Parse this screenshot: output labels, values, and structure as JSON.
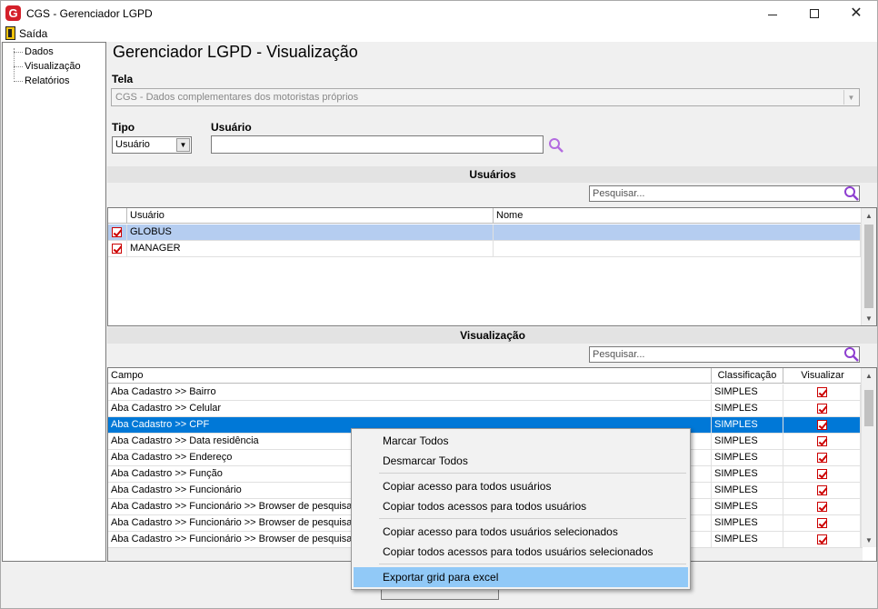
{
  "window": {
    "app_logo_letter": "G",
    "title": "CGS - Gerenciador LGPD",
    "minimize_icon": "minimize-icon",
    "maximize_icon": "maximize-icon",
    "close_icon": "close-icon"
  },
  "menu": {
    "exit_label": "Saída"
  },
  "sidebar": {
    "items": [
      {
        "label": "Dados"
      },
      {
        "label": "Visualização"
      },
      {
        "label": "Relatórios"
      }
    ]
  },
  "main": {
    "title": "Gerenciador LGPD - Visualização",
    "tela_label": "Tela",
    "tela_value": "CGS - Dados complementares dos motoristas próprios",
    "tipo_label": "Tipo",
    "tipo_value": "Usuário",
    "usuario_label": "Usuário",
    "usuario_value": ""
  },
  "usuarios_section": {
    "title": "Usuários",
    "search_placeholder": "Pesquisar...",
    "columns": [
      "Usuário",
      "Nome"
    ],
    "rows": [
      {
        "checked": true,
        "usuario": "GLOBUS",
        "nome": ""
      },
      {
        "checked": true,
        "usuario": "MANAGER",
        "nome": ""
      }
    ]
  },
  "visualizacao_section": {
    "title": "Visualização",
    "search_placeholder": "Pesquisar...",
    "columns": [
      "Campo",
      "Classificação",
      "Visualizar"
    ],
    "rows": [
      {
        "campo": "Aba Cadastro >> Bairro",
        "classificacao": "SIMPLES",
        "visualizar": true
      },
      {
        "campo": "Aba Cadastro >> Celular",
        "classificacao": "SIMPLES",
        "visualizar": true
      },
      {
        "campo": "Aba Cadastro >> CPF",
        "classificacao": "SIMPLES",
        "visualizar": true
      },
      {
        "campo": "Aba Cadastro >> Data residência",
        "classificacao": "SIMPLES",
        "visualizar": true
      },
      {
        "campo": "Aba Cadastro >> Endereço",
        "classificacao": "SIMPLES",
        "visualizar": true
      },
      {
        "campo": "Aba Cadastro >> Função",
        "classificacao": "SIMPLES",
        "visualizar": true
      },
      {
        "campo": "Aba Cadastro >> Funcionário",
        "classificacao": "SIMPLES",
        "visualizar": true
      },
      {
        "campo": "Aba Cadastro >> Funcionário >> Browser de pesquisa >>",
        "classificacao": "SIMPLES",
        "visualizar": true
      },
      {
        "campo": "Aba Cadastro >> Funcionário >> Browser de pesquisa >>",
        "classificacao": "SIMPLES",
        "visualizar": true
      },
      {
        "campo": "Aba Cadastro >> Funcionário >> Browser de pesquisa >>",
        "classificacao": "SIMPLES",
        "visualizar": true
      }
    ]
  },
  "context_menu": {
    "items": [
      "Marcar Todos",
      "Desmarcar Todos",
      "Copiar acesso para todos usuários",
      "Copiar todos acessos para todos usuários",
      "Copiar acesso para todos usuários selecionados",
      "Copiar todos acessos para todos usuários selecionados",
      "Exportar grid para excel"
    ]
  },
  "colors": {
    "selection_dark": "#0078d7",
    "selection_light": "#b5cdf0",
    "menu_highlight": "#91c9f7",
    "search_icon": "#8e3fd0",
    "check_red": "#cc0000"
  }
}
